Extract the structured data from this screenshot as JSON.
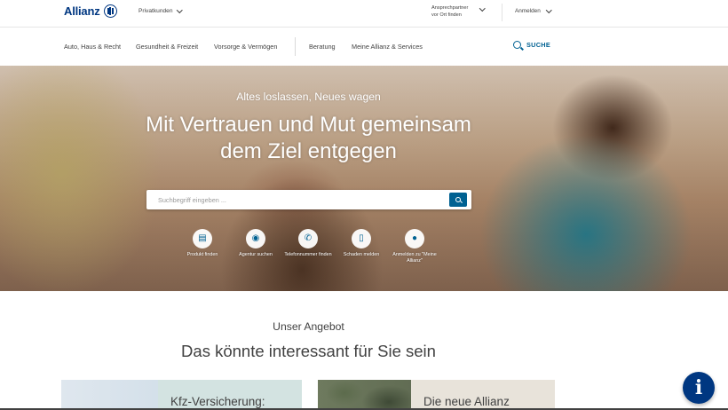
{
  "brand": {
    "name": "Allianz",
    "primary": "#003781",
    "accent": "#006192"
  },
  "topbar": {
    "segment": "Privatkunden",
    "contact_line1": "Ansprechpartner",
    "contact_line2": "vor Ort finden",
    "login": "Anmelden"
  },
  "nav": {
    "items": [
      "Auto, Haus & Recht",
      "Gesundheit & Freizeit",
      "Vorsorge & Vermögen",
      "Beratung",
      "Meine Allianz & Services"
    ],
    "search_label": "SUCHE"
  },
  "hero": {
    "subtitle": "Altes loslassen, Neues wagen",
    "title_line1": "Mit Vertrauen und Mut gemeinsam",
    "title_line2": "dem Ziel entgegen",
    "search_placeholder": "Suchbegriff eingeben ...",
    "quicklinks": [
      {
        "label": "Produkt finden",
        "icon": "document-icon"
      },
      {
        "label": "Agentur suchen",
        "icon": "location-pin-icon"
      },
      {
        "label": "Telefonnummer finden",
        "icon": "phone-icon"
      },
      {
        "label": "Schaden melden",
        "icon": "mobile-icon"
      },
      {
        "label": "Anmelden zu \"Meine Allianz\"",
        "icon": "user-icon"
      }
    ]
  },
  "offer": {
    "subtitle": "Unser Angebot",
    "title": "Das könnte interessant für Sie sein",
    "cards": [
      {
        "title": "Kfz-Versicherung:"
      },
      {
        "title": "Die neue Allianz"
      }
    ]
  },
  "info_button": "i"
}
